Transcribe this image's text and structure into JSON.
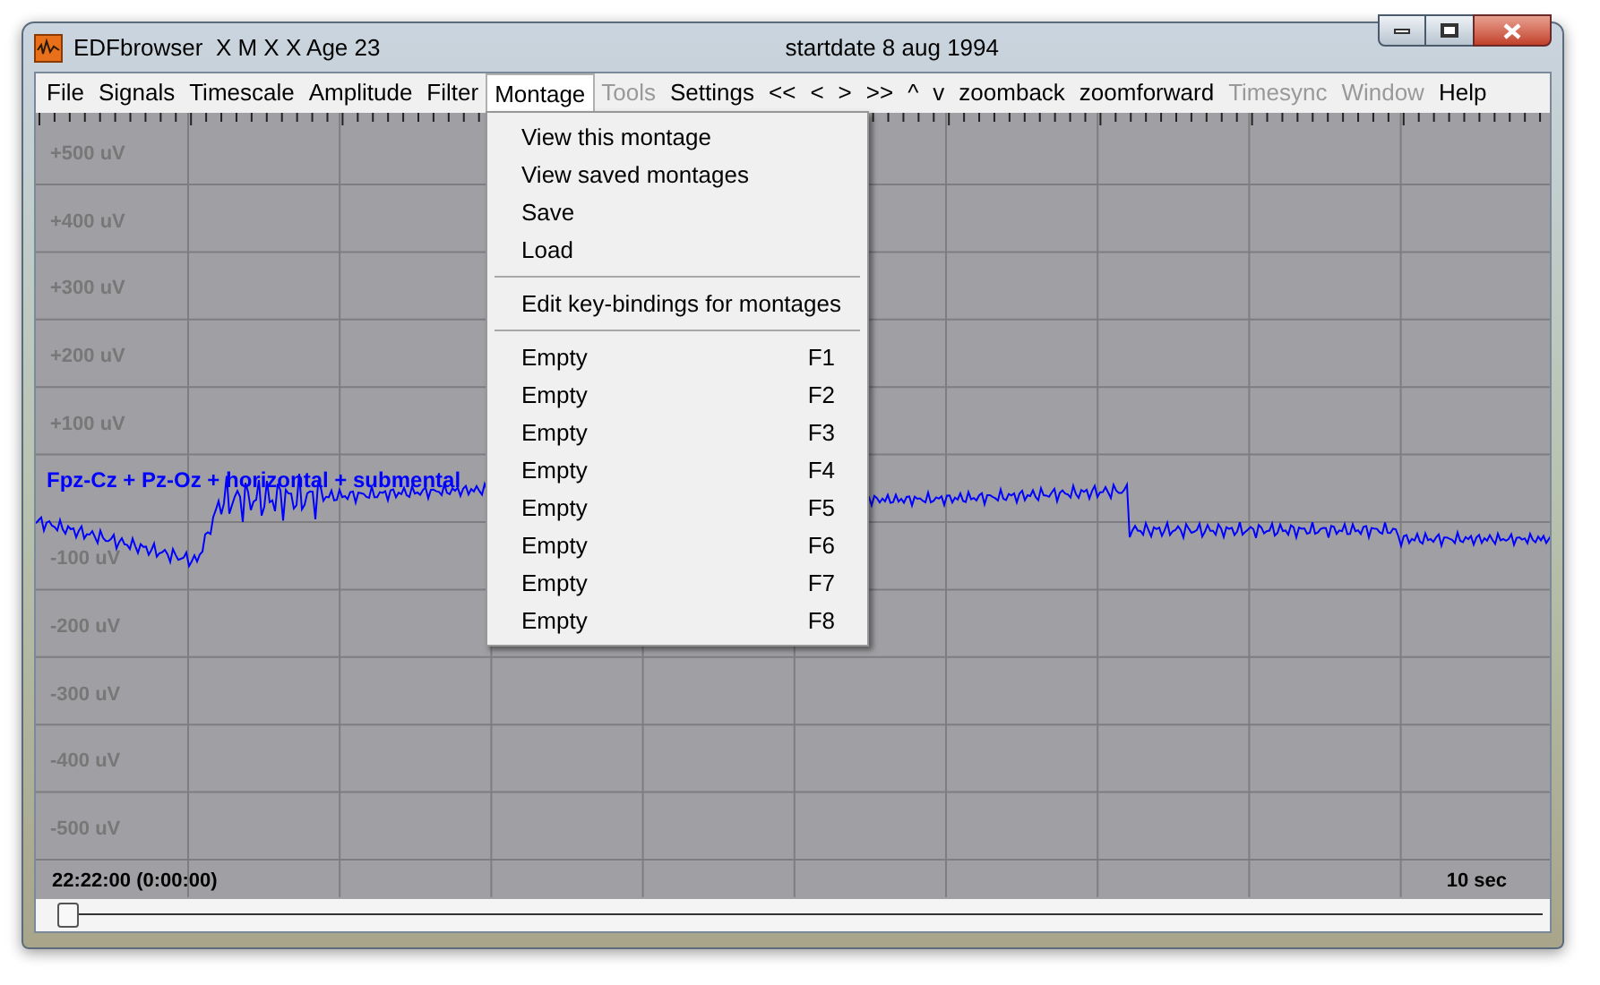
{
  "window": {
    "title": "EDFbrowser  X M X X Age 23",
    "subtitle": "startdate 8 aug 1994"
  },
  "menu": [
    {
      "label": "File",
      "disabled": false,
      "selected": false
    },
    {
      "label": "Signals",
      "disabled": false,
      "selected": false
    },
    {
      "label": "Timescale",
      "disabled": false,
      "selected": false
    },
    {
      "label": "Amplitude",
      "disabled": false,
      "selected": false
    },
    {
      "label": "Filter",
      "disabled": false,
      "selected": false
    },
    {
      "label": "Montage",
      "disabled": false,
      "selected": true
    },
    {
      "label": "Tools",
      "disabled": true,
      "selected": false
    },
    {
      "label": "Settings",
      "disabled": false,
      "selected": false
    },
    {
      "label": "<<",
      "disabled": false,
      "selected": false
    },
    {
      "label": "<",
      "disabled": false,
      "selected": false
    },
    {
      "label": ">",
      "disabled": false,
      "selected": false
    },
    {
      "label": ">>",
      "disabled": false,
      "selected": false
    },
    {
      "label": "^",
      "disabled": false,
      "selected": false
    },
    {
      "label": "v",
      "disabled": false,
      "selected": false
    },
    {
      "label": "zoomback",
      "disabled": false,
      "selected": false
    },
    {
      "label": "zoomforward",
      "disabled": false,
      "selected": false
    },
    {
      "label": "Timesync",
      "disabled": true,
      "selected": false
    },
    {
      "label": "Window",
      "disabled": true,
      "selected": false
    },
    {
      "label": "Help",
      "disabled": false,
      "selected": false
    }
  ],
  "dropdown": [
    {
      "kind": "item",
      "label": "View this montage"
    },
    {
      "kind": "item",
      "label": "View saved montages"
    },
    {
      "kind": "item",
      "label": "Save"
    },
    {
      "kind": "item",
      "label": "Load"
    },
    {
      "kind": "separator"
    },
    {
      "kind": "item",
      "label": "Edit key-bindings for montages"
    },
    {
      "kind": "separator"
    },
    {
      "kind": "item",
      "label": "Empty",
      "shortcut": "F1"
    },
    {
      "kind": "item",
      "label": "Empty",
      "shortcut": "F2"
    },
    {
      "kind": "item",
      "label": "Empty",
      "shortcut": "F3"
    },
    {
      "kind": "item",
      "label": "Empty",
      "shortcut": "F4"
    },
    {
      "kind": "item",
      "label": "Empty",
      "shortcut": "F5"
    },
    {
      "kind": "item",
      "label": "Empty",
      "shortcut": "F6"
    },
    {
      "kind": "item",
      "label": "Empty",
      "shortcut": "F7"
    },
    {
      "kind": "item",
      "label": "Empty",
      "shortcut": "F8"
    }
  ],
  "plot": {
    "upper_labels": [
      "+500 uV",
      "+400 uV",
      "+300 uV",
      "+200 uV",
      "+100 uV"
    ],
    "lower_labels": [
      "-100 uV",
      "-200 uV",
      "-300 uV",
      "-400 uV",
      "-500 uV"
    ],
    "signal_label": "Fpz-Cz + Pz-Oz + horizontal + submental",
    "start_time": "22:22:00 (0:00:00)",
    "timescale": "10 sec"
  }
}
